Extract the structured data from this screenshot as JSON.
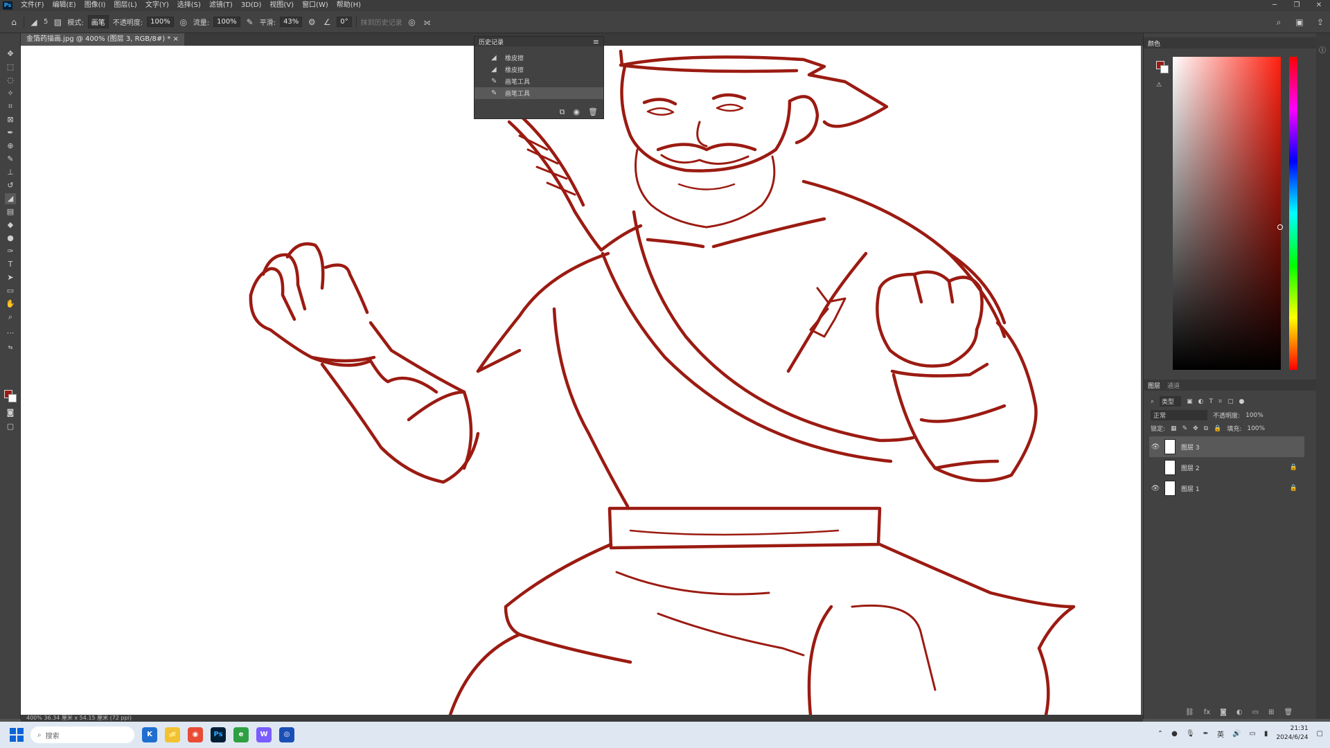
{
  "menu": {
    "logo": "Ps",
    "items": [
      "文件(F)",
      "编辑(E)",
      "图像(I)",
      "图层(L)",
      "文字(Y)",
      "选择(S)",
      "滤镜(T)",
      "3D(D)",
      "视图(V)",
      "窗口(W)",
      "帮助(H)"
    ]
  },
  "options": {
    "brush_size": "5",
    "mode_label": "模式:",
    "mode_value": "画笔",
    "opacity_label": "不透明度:",
    "opacity_value": "100%",
    "flow_label": "流量:",
    "flow_value": "100%",
    "smooth_label": "平滑:",
    "smooth_value": "43%",
    "angle_value": "0°",
    "erase_history": "抹到历史记录"
  },
  "document": {
    "tab_title": "金箔药描画.jpg @ 400% (图层 3, RGB/8#) *",
    "status": "400%  36.34 厘米 x 54.15 厘米 (72 ppi)"
  },
  "history": {
    "title": "历史记录",
    "items": [
      {
        "label": "橡皮擦",
        "icon": "eraser-icon"
      },
      {
        "label": "橡皮擦",
        "icon": "eraser-icon"
      },
      {
        "label": "画笔工具",
        "icon": "brush-icon"
      },
      {
        "label": "画笔工具",
        "icon": "brush-icon",
        "active": true
      }
    ]
  },
  "color_panel": {
    "tab": "颜色",
    "foreground": "#9b1b12",
    "background": "#ffffff"
  },
  "layers_panel": {
    "tabs": [
      "图层",
      "通道"
    ],
    "kind_filter": "类型",
    "blend_mode": "正常",
    "opacity_label": "不透明度:",
    "opacity_value": "100%",
    "lock_label": "锁定:",
    "fill_label": "填充:",
    "fill_value": "100%",
    "layers": [
      {
        "name": "图层 3",
        "visible": true,
        "locked": false,
        "active": true
      },
      {
        "name": "图层 2",
        "visible": false,
        "locked": true,
        "active": false
      },
      {
        "name": "图层 1",
        "visible": true,
        "locked": true,
        "active": false
      }
    ]
  },
  "taskbar": {
    "search_placeholder": "搜索",
    "apps": [
      "K",
      "📁",
      "◉",
      "Ps",
      "e",
      "W",
      "◎"
    ],
    "ime": "英",
    "time": "21:31",
    "date": "2024/6/24"
  },
  "colors": {
    "stroke": "#9b1b12",
    "ui_dark": "#424242",
    "taskbar": "#dfe8f2"
  }
}
